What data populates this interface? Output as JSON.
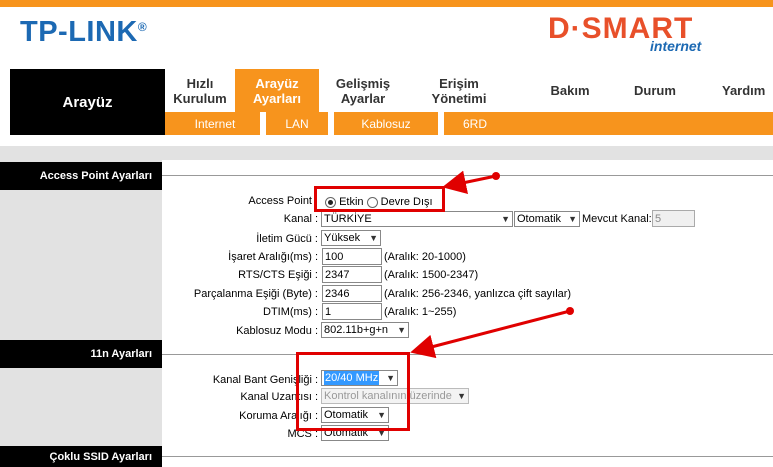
{
  "brand": {
    "logo": "TP-LINK",
    "logo_mark": "®",
    "partner": "D·SMART",
    "partner_sub": "internet"
  },
  "nav": {
    "left_title": "Arayüz",
    "tabs": [
      {
        "label1": "Hızlı",
        "label2": "Kurulum"
      },
      {
        "label1": "Arayüz",
        "label2": "Ayarları"
      },
      {
        "label1": "Gelişmiş",
        "label2": "Ayarlar"
      },
      {
        "label1": "Erişim",
        "label2": "Yönetimi"
      },
      {
        "label1": "Bakım",
        "label2": ""
      },
      {
        "label1": "Durum",
        "label2": ""
      },
      {
        "label1": "Yardım",
        "label2": ""
      }
    ],
    "subtabs": [
      "Internet",
      "LAN",
      "Kablosuz",
      "6RD"
    ]
  },
  "sections": {
    "ap": "Access Point Ayarları",
    "n11": "11n Ayarları",
    "ssid": "Çoklu SSID Ayarları"
  },
  "ap": {
    "access_point_label": "Access Point",
    "opt_on": "Etkin",
    "opt_off": "Devre Dışı",
    "kanal_label": "Kanal :",
    "kanal_value": "TÜRKİYE",
    "kanal_mode": "Otomatik",
    "mevcut_label": "Mevcut Kanal:",
    "mevcut_value": "5",
    "guc_label": "İletim Gücü :",
    "guc_value": "Yüksek",
    "isaret_label": "İşaret Aralığı(ms) :",
    "isaret_value": "100",
    "isaret_hint": "(Aralık: 20-1000)",
    "rts_label": "RTS/CTS Eşiği :",
    "rts_value": "2347",
    "rts_hint": "(Aralık: 1500-2347)",
    "parca_label": "Parçalanma Eşiği (Byte) :",
    "parca_value": "2346",
    "parca_hint": "(Aralık: 256-2346, yanlızca çift sayılar)",
    "dtim_label": "DTIM(ms) :",
    "dtim_value": "1",
    "dtim_hint": "(Aralık: 1~255)",
    "mod_label": "Kablosuz Modu :",
    "mod_value": "802.11b+g+n"
  },
  "n11": {
    "bw_label": "Kanal Bant Genişliği :",
    "bw_value": "20/40 MHz",
    "ext_label": "Kanal Uzantısı :",
    "ext_value": "Kontrol kanalının üzerinde",
    "guard_label": "Koruma Aralığı :",
    "guard_value": "Otomatik",
    "mcs_label": "MCS :",
    "mcs_value": "Otomatik"
  },
  "colors": {
    "accent": "#f7941d",
    "brand_blue": "#1c69b3",
    "partner_red": "#e8502a",
    "annotation": "#e00000"
  }
}
